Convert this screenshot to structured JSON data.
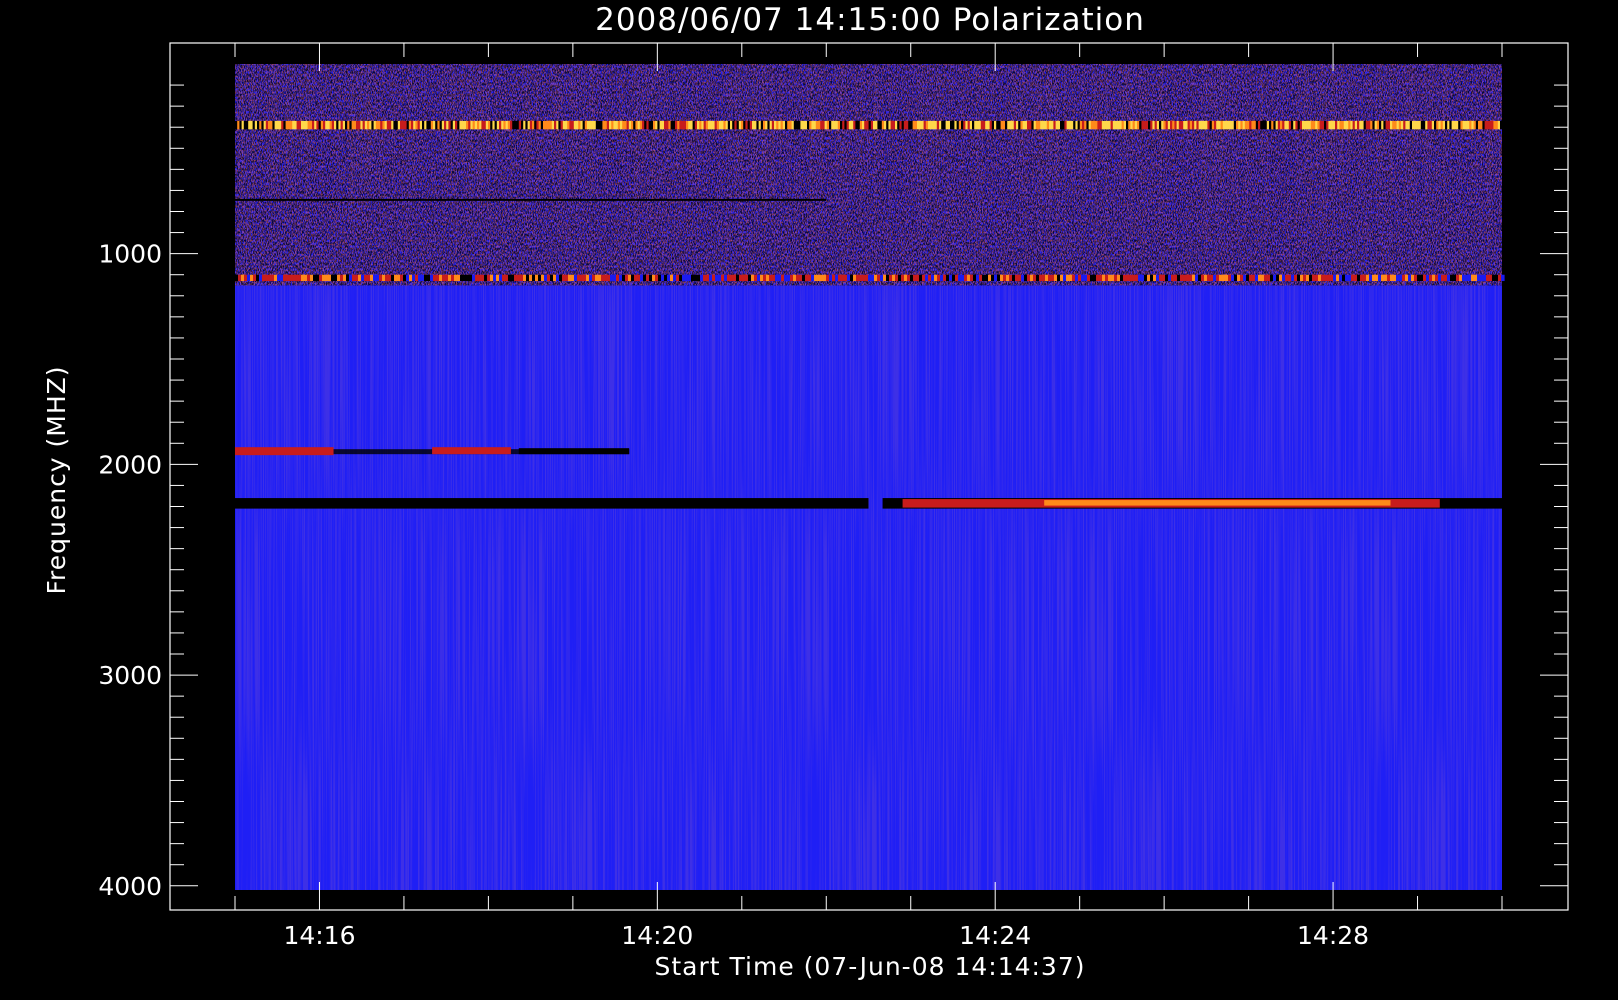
{
  "chart_data": {
    "type": "heatmap",
    "title": "2008/06/07 14:15:00 Polarization",
    "xlabel": "Start Time (07-Jun-08 14:14:37)",
    "ylabel": "Frequency (MHZ)",
    "x_range": [
      "14:15:00",
      "14:30:00"
    ],
    "y_range": [
      100,
      4020
    ],
    "y_reversed": true,
    "x_ticks": [
      "14:16",
      "14:20",
      "14:24",
      "14:28"
    ],
    "y_ticks": [
      1000,
      2000,
      3000,
      4000
    ],
    "colormap": [
      "#000000",
      "#1b1bf0",
      "#c81c1c",
      "#ff8a1a",
      "#ffd84a"
    ],
    "background_color": "#1f1ff5",
    "features": [
      {
        "name": "noisy-low-frequency-band",
        "freq": [
          100,
          1150
        ],
        "time": [
          "14:15:00",
          "14:30:00"
        ],
        "level": "mixed"
      },
      {
        "name": "bright-band",
        "freq": [
          370,
          410
        ],
        "time": [
          "14:15:00",
          "14:30:00"
        ],
        "level": "high"
      },
      {
        "name": "red-dotted-line",
        "freq": [
          1100,
          1130
        ],
        "time": [
          "14:15:00",
          "14:30:00"
        ],
        "level": "medium"
      },
      {
        "name": "dark-line",
        "freq": [
          740,
          760
        ],
        "time": [
          "14:15:00",
          "14:22:00"
        ],
        "level": "low"
      },
      {
        "name": "polarized-burst-1900",
        "freq": [
          1890,
          1940
        ],
        "time": [
          "14:15:00",
          "14:19:40"
        ],
        "level": "medium"
      },
      {
        "name": "dark-band-2180",
        "freq": [
          2160,
          2210
        ],
        "time": [
          "14:15:00",
          "14:22:30"
        ],
        "level": "low"
      },
      {
        "name": "polarized-burst-2190",
        "freq": [
          2160,
          2210
        ],
        "time": [
          "14:22:40",
          "14:29:30"
        ],
        "level": "high"
      }
    ]
  }
}
